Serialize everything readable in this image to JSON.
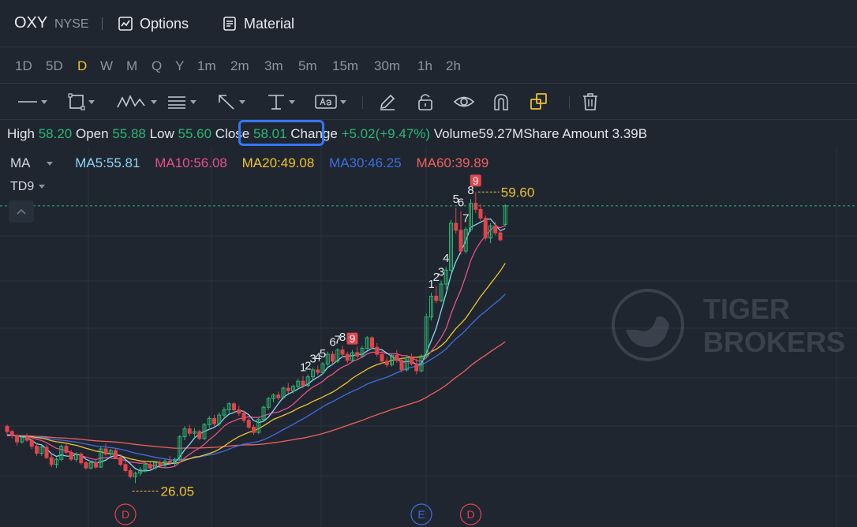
{
  "header": {
    "ticker": "OXY",
    "exchange": "NYSE",
    "options_label": "Options",
    "material_label": "Material"
  },
  "timeframes": [
    "1D",
    "5D",
    "D",
    "W",
    "M",
    "Q",
    "Y",
    "1m",
    "2m",
    "3m",
    "5m",
    "15m",
    "30m",
    "1h",
    "2h"
  ],
  "active_timeframe": "D",
  "drawing_tools": [
    "line-icon",
    "rectangle-icon",
    "pattern-icon",
    "fib-icon",
    "arrow-icon",
    "horizontal-line-icon",
    "text-icon",
    "pencil-icon",
    "lock-icon",
    "eye-icon",
    "magnet-icon",
    "layers-icon",
    "trash-icon"
  ],
  "stats": {
    "high_label": "High",
    "high": "58.20",
    "open_label": "Open",
    "open": "55.88",
    "low_label": "Low",
    "low": "55.60",
    "close_label": "Close",
    "close": "58.01",
    "change_label": "Change",
    "change": "+5.02(+9.47%)",
    "volume_label": "Volume",
    "volume": "59.27M",
    "share_amount_label": "Share Amount",
    "share_amount": "3.39B"
  },
  "indicators": {
    "ma_label": "MA",
    "ma5": "MA5:55.81",
    "ma10": "MA10:56.08",
    "ma20": "MA20:49.08",
    "ma30": "MA30:46.25",
    "ma60": "MA60:39.89",
    "td_label": "TD9"
  },
  "colors": {
    "up": "#2bb673",
    "down": "#e0444c",
    "ma5": "#8fd3f5",
    "ma10": "#e8508a",
    "ma20": "#f0c22f",
    "ma30": "#3f6ee0",
    "ma60": "#f0605f",
    "accent": "#f0c22f",
    "highlight": "#3478f6"
  },
  "chart_data": {
    "type": "candlestick",
    "ylim": [
      24,
      62
    ],
    "high_marker": "59.60",
    "low_marker": "26.05",
    "current_price_line": 58.01,
    "td_labels": [
      {
        "text": "1",
        "i": 60
      },
      {
        "text": "2",
        "i": 61
      },
      {
        "text": "3",
        "i": 62
      },
      {
        "text": "4",
        "i": 63
      },
      {
        "text": "5",
        "i": 64
      },
      {
        "text": "6",
        "i": 66
      },
      {
        "text": "7",
        "i": 67
      },
      {
        "text": "8",
        "i": 68
      },
      {
        "text": "9",
        "i": 70,
        "box": true
      },
      {
        "text": "1",
        "i": 86
      },
      {
        "text": "2",
        "i": 87
      },
      {
        "text": "3",
        "i": 88
      },
      {
        "text": "4",
        "i": 89
      },
      {
        "text": "5",
        "i": 91
      },
      {
        "text": "6",
        "i": 92
      },
      {
        "text": "7",
        "i": 93
      },
      {
        "text": "8",
        "i": 94
      },
      {
        "text": "9",
        "i": 95,
        "box": true
      }
    ],
    "event_markers": [
      {
        "text": "D",
        "i": 24,
        "color": "#e0444c"
      },
      {
        "text": "E",
        "i": 84,
        "color": "#3f6ee0"
      },
      {
        "text": "D",
        "i": 94,
        "color": "#e0444c"
      }
    ],
    "candles": [
      [
        32.6,
        32.8,
        31.6,
        32.0
      ],
      [
        32.0,
        32.2,
        31.2,
        31.5
      ],
      [
        31.5,
        31.7,
        30.4,
        30.8
      ],
      [
        30.8,
        31.5,
        30.6,
        31.3
      ],
      [
        31.3,
        31.8,
        30.8,
        31.0
      ],
      [
        31.0,
        31.2,
        30.0,
        30.3
      ],
      [
        30.3,
        30.6,
        29.2,
        29.5
      ],
      [
        29.5,
        30.4,
        29.2,
        30.2
      ],
      [
        30.2,
        30.5,
        28.8,
        29.0
      ],
      [
        29.0,
        29.4,
        27.9,
        28.2
      ],
      [
        28.2,
        29.0,
        27.8,
        28.8
      ],
      [
        28.8,
        30.5,
        28.6,
        30.3
      ],
      [
        30.3,
        30.8,
        29.4,
        29.6
      ],
      [
        29.6,
        29.9,
        28.6,
        28.8
      ],
      [
        28.8,
        29.6,
        28.5,
        29.4
      ],
      [
        29.4,
        29.6,
        28.2,
        28.4
      ],
      [
        28.4,
        28.6,
        27.6,
        27.8
      ],
      [
        27.8,
        28.6,
        27.6,
        28.4
      ],
      [
        28.4,
        28.8,
        27.7,
        27.9
      ],
      [
        27.9,
        30.2,
        27.8,
        30.0
      ],
      [
        30.0,
        30.6,
        29.2,
        29.4
      ],
      [
        29.4,
        30.0,
        29.0,
        29.8
      ],
      [
        29.8,
        30.1,
        28.8,
        29.0
      ],
      [
        29.0,
        29.3,
        28.0,
        28.2
      ],
      [
        28.2,
        28.5,
        27.3,
        27.5
      ],
      [
        27.5,
        27.8,
        26.6,
        26.8
      ],
      [
        26.8,
        27.4,
        26.05,
        27.2
      ],
      [
        27.2,
        27.9,
        26.9,
        27.6
      ],
      [
        27.6,
        28.4,
        27.3,
        28.2
      ],
      [
        28.2,
        28.5,
        27.6,
        27.8
      ],
      [
        27.8,
        28.6,
        27.6,
        28.4
      ],
      [
        28.4,
        28.7,
        27.9,
        28.1
      ],
      [
        28.1,
        28.8,
        27.8,
        28.6
      ],
      [
        28.6,
        29.2,
        28.2,
        28.4
      ],
      [
        28.4,
        29.0,
        28.0,
        28.8
      ],
      [
        28.8,
        31.6,
        28.6,
        31.4
      ],
      [
        31.4,
        32.6,
        31.0,
        32.3
      ],
      [
        32.3,
        32.8,
        31.5,
        31.8
      ],
      [
        31.8,
        32.4,
        31.4,
        32.0
      ],
      [
        32.0,
        32.2,
        31.0,
        31.2
      ],
      [
        31.2,
        33.0,
        31.0,
        32.8
      ],
      [
        32.8,
        33.8,
        32.4,
        33.5
      ],
      [
        33.5,
        33.9,
        32.6,
        32.9
      ],
      [
        32.9,
        34.2,
        32.6,
        33.9
      ],
      [
        33.9,
        34.8,
        33.6,
        34.5
      ],
      [
        34.5,
        35.4,
        34.0,
        35.2
      ],
      [
        35.2,
        35.4,
        34.2,
        34.5
      ],
      [
        34.5,
        35.0,
        33.8,
        34.1
      ],
      [
        34.1,
        34.4,
        33.0,
        33.3
      ],
      [
        33.3,
        33.6,
        32.3,
        32.5
      ],
      [
        32.5,
        32.8,
        31.6,
        31.9
      ],
      [
        31.9,
        33.6,
        31.7,
        33.4
      ],
      [
        33.4,
        35.0,
        33.2,
        34.8
      ],
      [
        34.8,
        36.0,
        34.5,
        35.8
      ],
      [
        35.8,
        36.4,
        35.4,
        36.2
      ],
      [
        36.2,
        36.6,
        35.6,
        35.9
      ],
      [
        35.9,
        37.2,
        35.7,
        37.0
      ],
      [
        37.0,
        37.6,
        36.4,
        36.7
      ],
      [
        36.7,
        37.4,
        36.4,
        37.2
      ],
      [
        37.2,
        38.1,
        36.9,
        37.8
      ],
      [
        37.8,
        38.4,
        37.0,
        37.3
      ],
      [
        37.3,
        38.6,
        37.1,
        38.3
      ],
      [
        38.3,
        39.4,
        38.0,
        39.1
      ],
      [
        39.1,
        39.6,
        38.5,
        38.8
      ],
      [
        38.8,
        40.0,
        38.6,
        39.8
      ],
      [
        39.8,
        41.2,
        39.5,
        40.9
      ],
      [
        40.9,
        41.3,
        39.8,
        40.1
      ],
      [
        40.1,
        41.6,
        39.9,
        41.4
      ],
      [
        41.4,
        41.9,
        40.6,
        40.9
      ],
      [
        40.9,
        41.2,
        39.9,
        40.2
      ],
      [
        40.2,
        41.4,
        40.0,
        41.1
      ],
      [
        41.1,
        41.8,
        40.4,
        40.7
      ],
      [
        40.7,
        41.9,
        40.5,
        41.6
      ],
      [
        41.6,
        43.0,
        41.4,
        42.8
      ],
      [
        42.8,
        43.0,
        41.5,
        41.7
      ],
      [
        41.7,
        42.2,
        40.6,
        40.9
      ],
      [
        40.9,
        41.3,
        39.8,
        40.1
      ],
      [
        40.1,
        40.6,
        39.4,
        39.7
      ],
      [
        39.7,
        41.0,
        39.5,
        40.8
      ],
      [
        40.8,
        41.4,
        39.9,
        40.2
      ],
      [
        40.2,
        40.6,
        38.8,
        39.1
      ],
      [
        39.1,
        40.8,
        38.9,
        40.5
      ],
      [
        40.5,
        41.0,
        39.6,
        39.8
      ],
      [
        39.8,
        40.4,
        38.6,
        39.0
      ],
      [
        39.0,
        40.9,
        38.8,
        40.7
      ],
      [
        40.7,
        45.6,
        40.5,
        45.2
      ],
      [
        45.2,
        48.0,
        44.8,
        47.6
      ],
      [
        47.6,
        48.8,
        46.8,
        47.1
      ],
      [
        47.1,
        49.4,
        46.9,
        49.0
      ],
      [
        49.0,
        51.0,
        48.4,
        50.6
      ],
      [
        50.6,
        56.4,
        50.4,
        56.0
      ],
      [
        56.0,
        57.8,
        54.8,
        55.2
      ],
      [
        55.2,
        57.4,
        52.4,
        52.8
      ],
      [
        52.8,
        55.6,
        52.5,
        55.3
      ],
      [
        55.3,
        58.8,
        55.0,
        58.3
      ],
      [
        58.3,
        59.6,
        57.2,
        57.6
      ],
      [
        57.6,
        58.2,
        56.3,
        56.6
      ],
      [
        56.6,
        56.9,
        54.0,
        54.3
      ],
      [
        54.3,
        56.0,
        53.7,
        55.7
      ],
      [
        55.7,
        56.2,
        54.6,
        54.9
      ],
      [
        54.9,
        55.2,
        53.9,
        54.1
      ],
      [
        55.88,
        58.2,
        55.6,
        58.01
      ]
    ]
  }
}
